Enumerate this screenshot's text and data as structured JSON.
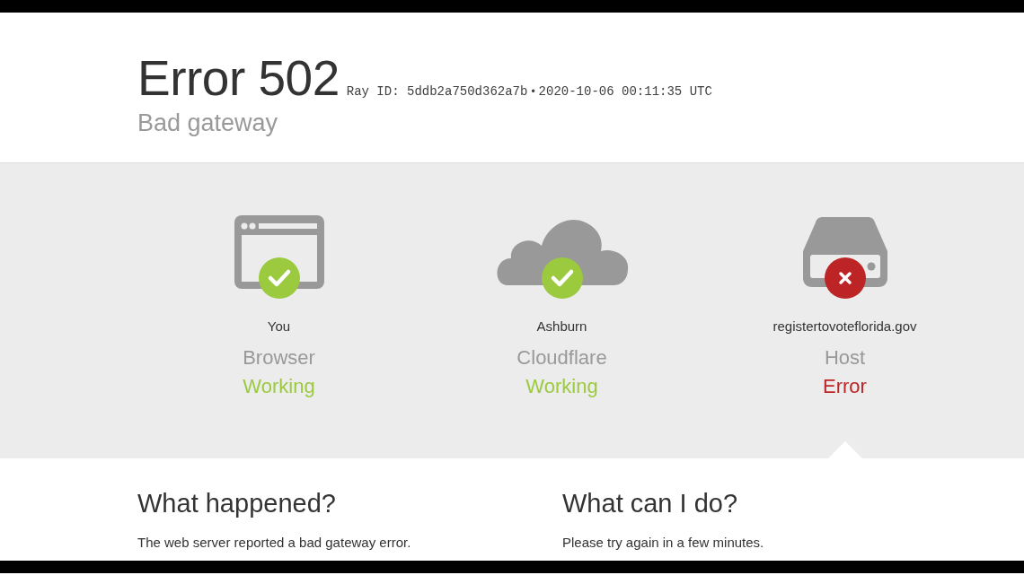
{
  "header": {
    "title": "Error 502",
    "ray_id": "Ray ID: 5ddb2a750d362a7b",
    "separator": "•",
    "timestamp": "2020-10-06 00:11:35 UTC",
    "subtitle": "Bad gateway"
  },
  "steps": [
    {
      "kind": "browser",
      "location": "You",
      "name": "Browser",
      "status": "Working",
      "error": false,
      "selected": false
    },
    {
      "kind": "cloud",
      "location": "Ashburn",
      "name": "Cloudflare",
      "status": "Working",
      "error": false,
      "selected": false
    },
    {
      "kind": "server",
      "location": "registertovoteflorida.gov",
      "name": "Host",
      "status": "Error",
      "error": true,
      "selected": true
    }
  ],
  "sections": [
    {
      "heading": "What happened?",
      "text": "The web server reported a bad gateway error."
    },
    {
      "heading": "What can I do?",
      "text": "Please try again in a few minutes."
    }
  ]
}
